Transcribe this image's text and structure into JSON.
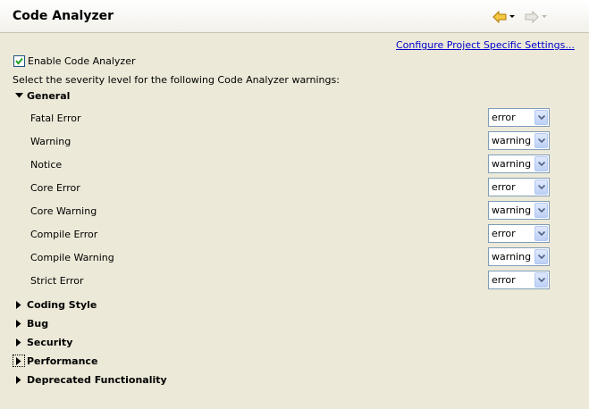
{
  "header": {
    "title": "Code Analyzer",
    "back_icon": "back-arrow-icon",
    "forward_icon": "forward-arrow-icon"
  },
  "configure_link": "Configure Project Specific Settings...",
  "enable": {
    "label": "Enable Code Analyzer",
    "checked": true
  },
  "instructions": "Select the severity level for the following Code Analyzer warnings:",
  "general": {
    "label": "General",
    "expanded": true,
    "rows": [
      {
        "label": "Fatal Error",
        "value": "error"
      },
      {
        "label": "Warning",
        "value": "warning"
      },
      {
        "label": "Notice",
        "value": "warning"
      },
      {
        "label": "Core Error",
        "value": "error"
      },
      {
        "label": "Core Warning",
        "value": "warning"
      },
      {
        "label": "Compile Error",
        "value": "error"
      },
      {
        "label": "Compile Warning",
        "value": "warning"
      },
      {
        "label": "Strict Error",
        "value": "error"
      }
    ]
  },
  "sections": [
    {
      "label": "Coding Style",
      "expanded": false
    },
    {
      "label": "Bug",
      "expanded": false
    },
    {
      "label": "Security",
      "expanded": false
    },
    {
      "label": "Performance",
      "expanded": false
    },
    {
      "label": "Deprecated Functionality",
      "expanded": false
    }
  ],
  "colors": {
    "background": "#ece9d8",
    "link": "#0000cc",
    "checkmark": "#21a121",
    "back_arrow": "#f0b020"
  }
}
